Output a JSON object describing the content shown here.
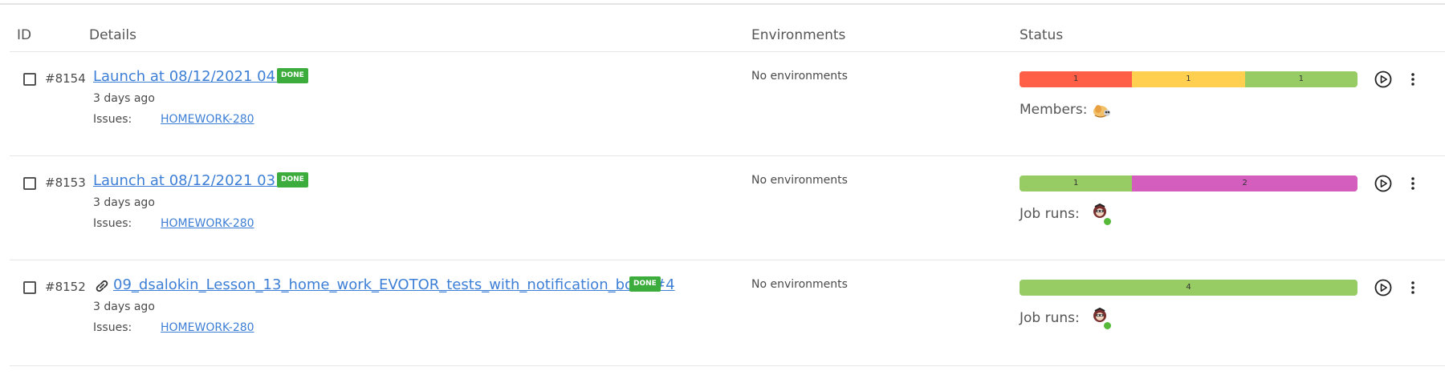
{
  "table": {
    "columns": {
      "id": "ID",
      "details": "Details",
      "environments": "Environments",
      "status": "Status"
    }
  },
  "colors": {
    "failed": "#ff5f46",
    "broken": "#ffd050",
    "passed": "#97cc64",
    "skipped": "#d35ebe",
    "link": "#3d7fd6",
    "done_badge": "#3cac3c"
  },
  "rows": [
    {
      "id": "#8154",
      "title": "Launch at 08/12/2021 04:04",
      "badge": "DONE",
      "ago": "3 days ago",
      "issues_label": "Issues:",
      "issue": "HOMEWORK-280",
      "environments": "No environments",
      "segments": [
        {
          "label": "1",
          "value": 1,
          "color": "#ff5f46"
        },
        {
          "label": "1",
          "value": 1,
          "color": "#ffd050"
        },
        {
          "label": "1",
          "value": 1,
          "color": "#97cc64"
        }
      ],
      "meta_label": "Members:",
      "avatar_icon": "member-avatar-icon"
    },
    {
      "id": "#8153",
      "title": "Launch at 08/12/2021 03:50",
      "badge": "DONE",
      "ago": "3 days ago",
      "issues_label": "Issues:",
      "issue": "HOMEWORK-280",
      "environments": "No environments",
      "segments": [
        {
          "label": "1",
          "value": 1,
          "color": "#97cc64"
        },
        {
          "label": "2",
          "value": 2,
          "color": "#d35ebe"
        }
      ],
      "meta_label": "Job runs:",
      "avatar_icon": "job-run-avatar-icon"
    },
    {
      "id": "#8152",
      "title": "09_dsalokin_Lesson_13_home_work_EVOTOR_tests_with_notification_bot - #4",
      "badge": "DONE",
      "ago": "3 days ago",
      "issues_label": "Issues:",
      "issue": "HOMEWORK-280",
      "environments": "No environments",
      "segments": [
        {
          "label": "4",
          "value": 4,
          "color": "#97cc64"
        }
      ],
      "meta_label": "Job runs:",
      "avatar_icon": "job-run-avatar-icon"
    }
  ]
}
